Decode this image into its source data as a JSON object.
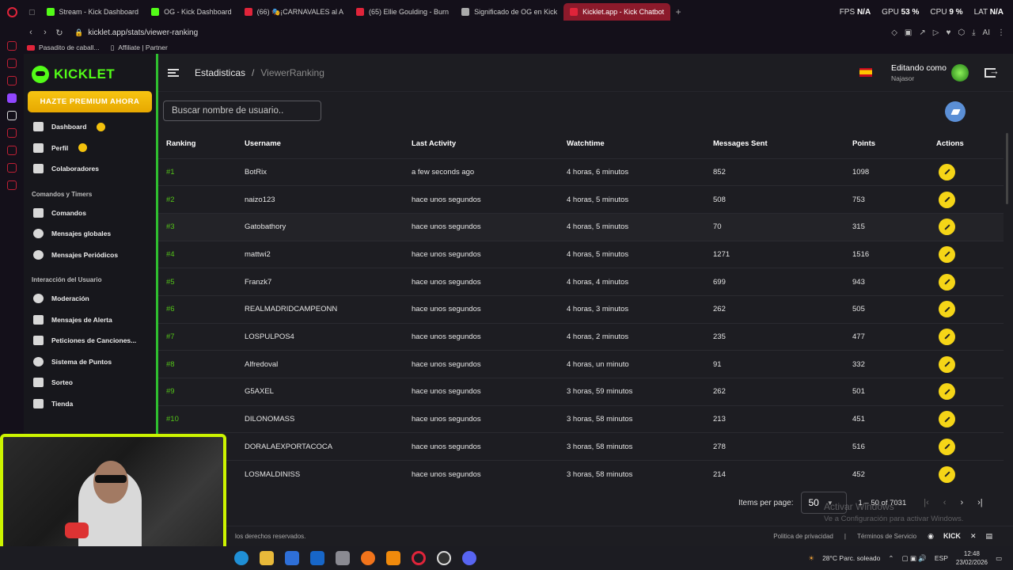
{
  "browser": {
    "tabs": [
      {
        "label": "Stream - Kick Dashboard",
        "color": "#53fc18",
        "active": false
      },
      {
        "label": "OG - Kick Dashboard",
        "color": "#53fc18",
        "active": false
      },
      {
        "label": "(66) 🎭¡CARNAVALES al A",
        "color": "#e0243a",
        "active": false
      },
      {
        "label": "(65) Ellie Goulding - Burn",
        "color": "#e0243a",
        "active": false
      },
      {
        "label": "Significado de OG en Kick",
        "color": "#aaaaaa",
        "active": false
      },
      {
        "label": "Kicklet.app - Kick Chatbot",
        "color": "#e0243a",
        "active": true
      }
    ],
    "new_tab": "+",
    "hud": {
      "fps_label": "FPS",
      "fps": "N/A",
      "gpu_label": "GPU",
      "gpu": "53 %",
      "cpu_label": "CPU",
      "cpu": "9 %",
      "lat_label": "LAT",
      "lat": "N/A"
    },
    "url": "kicklet.app/stats/viewer-ranking",
    "bookmarks": [
      {
        "label": "Pasadito de caball..."
      },
      {
        "label": "Affiliate | Partner"
      }
    ]
  },
  "sidebar": {
    "brand": "KICKLET",
    "premium": "HAZTE PREMIUM AHORA",
    "items_top": [
      {
        "label": "Dashboard",
        "icon": "dashboard-icon",
        "badge": true
      },
      {
        "label": "Perfil",
        "icon": "profile-icon",
        "badge": true
      },
      {
        "label": "Colaboradores",
        "icon": "collaborators-icon",
        "badge": false
      }
    ],
    "section_commands": "Comandos y Timers",
    "items_commands": [
      {
        "label": "Comandos",
        "icon": "wrench-icon"
      },
      {
        "label": "Mensajes globales",
        "icon": "chat-icon"
      },
      {
        "label": "Mensajes Periódicos",
        "icon": "clock-icon"
      }
    ],
    "section_interaction": "Interacción del Usuario",
    "items_interaction": [
      {
        "label": "Moderación",
        "icon": "shield-icon"
      },
      {
        "label": "Mensajes de Alerta",
        "icon": "alert-icon"
      },
      {
        "label": "Peticiones de Canciones...",
        "icon": "music-icon"
      },
      {
        "label": "Sistema de Puntos",
        "icon": "star-icon"
      },
      {
        "label": "Sorteo",
        "icon": "trophy-icon"
      },
      {
        "label": "Tienda",
        "icon": "cart-icon"
      }
    ]
  },
  "header": {
    "breadcrumb_root": "Estadisticas",
    "breadcrumb_sep": "/",
    "breadcrumb_current": "ViewerRanking",
    "editing_label": "Editando como",
    "editing_user": "Najasor"
  },
  "search": {
    "placeholder": "Buscar nombre de usuario.."
  },
  "table": {
    "columns": [
      "Ranking",
      "Username",
      "Last Activity",
      "Watchtime",
      "Messages Sent",
      "Points",
      "Actions"
    ],
    "rows": [
      {
        "rank": "#1",
        "user": "BotRix",
        "last": "a few seconds ago",
        "watch": "4 horas, 6 minutos",
        "msgs": "852",
        "points": "1098"
      },
      {
        "rank": "#2",
        "user": "naizo123",
        "last": "hace unos segundos",
        "watch": "4 horas, 5 minutos",
        "msgs": "508",
        "points": "753"
      },
      {
        "rank": "#3",
        "user": "Gatobathory",
        "last": "hace unos segundos",
        "watch": "4 horas, 5 minutos",
        "msgs": "70",
        "points": "315"
      },
      {
        "rank": "#4",
        "user": "mattwi2",
        "last": "hace unos segundos",
        "watch": "4 horas, 5 minutos",
        "msgs": "1271",
        "points": "1516"
      },
      {
        "rank": "#5",
        "user": "Franzk7",
        "last": "hace unos segundos",
        "watch": "4 horas, 4 minutos",
        "msgs": "699",
        "points": "943"
      },
      {
        "rank": "#6",
        "user": "REALMADRIDCAMPEONN",
        "last": "hace unos segundos",
        "watch": "4 horas, 3 minutos",
        "msgs": "262",
        "points": "505"
      },
      {
        "rank": "#7",
        "user": "LOSPULPOS4",
        "last": "hace unos segundos",
        "watch": "4 horas, 2 minutos",
        "msgs": "235",
        "points": "477"
      },
      {
        "rank": "#8",
        "user": "Alfredoval",
        "last": "hace unos segundos",
        "watch": "4 horas, un minuto",
        "msgs": "91",
        "points": "332"
      },
      {
        "rank": "#9",
        "user": "G5AXEL",
        "last": "hace unos segundos",
        "watch": "3 horas, 59 minutos",
        "msgs": "262",
        "points": "501"
      },
      {
        "rank": "#10",
        "user": "DILONOMASS",
        "last": "hace unos segundos",
        "watch": "3 horas, 58 minutos",
        "msgs": "213",
        "points": "451"
      },
      {
        "rank": "",
        "user": "DORALAEXPORTACOCA",
        "last": "hace unos segundos",
        "watch": "3 horas, 58 minutos",
        "msgs": "278",
        "points": "516"
      },
      {
        "rank": "",
        "user": "LOSMALDINISS",
        "last": "hace unos segundos",
        "watch": "3 horas, 58 minutos",
        "msgs": "214",
        "points": "452"
      }
    ]
  },
  "pager": {
    "items_label": "Items per page:",
    "items_value": "50",
    "range": "1 – 50 of 7031"
  },
  "watermark": {
    "title": "Activar Windows",
    "subtitle": "Ve a Configuración para activar Windows."
  },
  "footer": {
    "rights": "los derechos reservados.",
    "privacy": "Politica de privacidad",
    "sep": "|",
    "terms": "Términos de Servicio",
    "kick": "KICK"
  },
  "taskbar": {
    "weather": "28°C  Parc. soleado",
    "lang": "ESP",
    "time": "12:48",
    "date": "23/02/2026"
  }
}
